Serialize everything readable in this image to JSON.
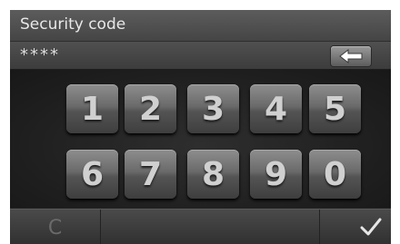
{
  "header": {
    "title": "Security code"
  },
  "code_entry": {
    "value": "****",
    "backspace_icon": "backspace-arrow-icon"
  },
  "keypad": {
    "keys": [
      "1",
      "2",
      "3",
      "4",
      "5",
      "6",
      "7",
      "8",
      "9",
      "0"
    ]
  },
  "footer": {
    "clear_label": "C",
    "confirm_icon": "checkmark-icon"
  },
  "colors": {
    "background": "#222222",
    "key_face": "#6a6a6a",
    "text": "#e8e8e8"
  }
}
